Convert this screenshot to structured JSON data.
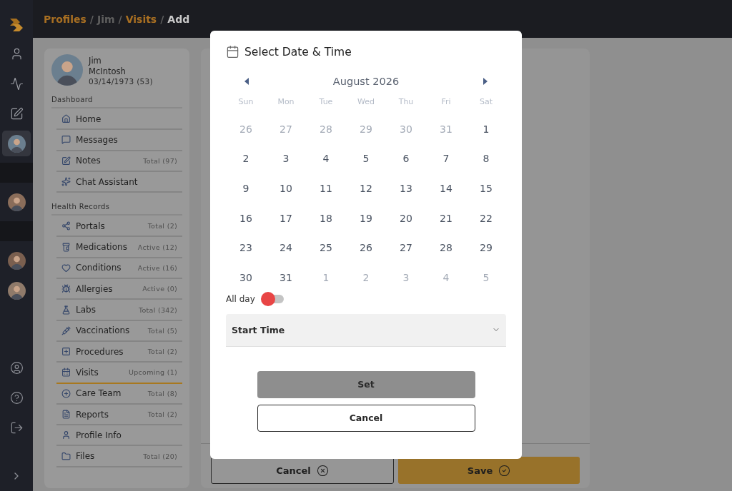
{
  "breadcrumb": [
    {
      "label": "Profiles",
      "kind": "link"
    },
    {
      "label": "/",
      "kind": "separator"
    },
    {
      "label": "Jim",
      "kind": "plain"
    },
    {
      "label": "/",
      "kind": "separator"
    },
    {
      "label": "Visits",
      "kind": "link"
    },
    {
      "label": "/",
      "kind": "separator"
    },
    {
      "label": "Add",
      "kind": "current"
    }
  ],
  "rail": [
    {
      "kind": "icon",
      "selected": false
    },
    {
      "kind": "icon",
      "selected": false
    },
    {
      "kind": "icon",
      "selected": false
    },
    {
      "kind": "avatar",
      "selected": true
    },
    {
      "kind": "band"
    },
    {
      "kind": "avatar",
      "selected": false
    },
    {
      "kind": "band"
    },
    {
      "kind": "avatar",
      "selected": false
    },
    {
      "kind": "avatar",
      "selected": false
    }
  ],
  "profile": {
    "first_name": "Jim",
    "last_name": "McIntosh",
    "birth": "03/14/1973 (53)"
  },
  "sections": [
    {
      "title": "Dashboard",
      "items": [
        {
          "label": "Home",
          "selected": false
        },
        {
          "label": "Messages",
          "selected": false
        },
        {
          "label": "Notes",
          "count": "Total (97)",
          "selected": false
        },
        {
          "label": "Chat Assistant",
          "selected": false
        }
      ]
    },
    {
      "title": "Health Records",
      "items": [
        {
          "label": "Portals",
          "count": "Total (2)",
          "selected": false
        },
        {
          "label": "Medications",
          "count": "Active (12)",
          "selected": false
        },
        {
          "label": "Conditions",
          "count": "Active (16)",
          "selected": false
        },
        {
          "label": "Allergies",
          "count": "Active (0)",
          "selected": false
        },
        {
          "label": "Labs",
          "count": "Total (342)",
          "selected": false
        },
        {
          "label": "Vaccinations",
          "count": "Total (5)",
          "selected": false
        },
        {
          "label": "Procedures",
          "count": "Total (2)",
          "selected": false
        },
        {
          "label": "Visits",
          "count": "Upcoming (1)",
          "selected": true
        },
        {
          "label": "Care Team",
          "count": "Total (8)",
          "selected": false
        },
        {
          "label": "Reports",
          "count": "Total (2)",
          "selected": false
        },
        {
          "label": "Profile Info",
          "selected": false
        },
        {
          "label": "Files",
          "count": "Total (20)",
          "selected": false
        }
      ]
    }
  ],
  "footer_buttons": [
    {
      "label": "Cancel",
      "kind": "outline"
    },
    {
      "label": "Save",
      "kind": "primary"
    }
  ],
  "dialog": {
    "title": "Select Date & Time",
    "month": "August 2026",
    "weekdays": [
      "Sun",
      "Mon",
      "Tue",
      "Wed",
      "Thu",
      "Fri",
      "Sat"
    ],
    "days": [
      {
        "label": "26",
        "muted": true
      },
      {
        "label": "27",
        "muted": true
      },
      {
        "label": "28",
        "muted": true
      },
      {
        "label": "29",
        "muted": true
      },
      {
        "label": "30",
        "muted": true
      },
      {
        "label": "31",
        "muted": true
      },
      {
        "label": "1",
        "muted": false
      },
      {
        "label": "2",
        "muted": false
      },
      {
        "label": "3",
        "muted": false
      },
      {
        "label": "4",
        "muted": false
      },
      {
        "label": "5",
        "muted": false
      },
      {
        "label": "6",
        "muted": false
      },
      {
        "label": "7",
        "muted": false
      },
      {
        "label": "8",
        "muted": false
      },
      {
        "label": "9",
        "muted": false
      },
      {
        "label": "10",
        "muted": false
      },
      {
        "label": "11",
        "muted": false
      },
      {
        "label": "12",
        "muted": false
      },
      {
        "label": "13",
        "muted": false
      },
      {
        "label": "14",
        "muted": false
      },
      {
        "label": "15",
        "muted": false
      },
      {
        "label": "16",
        "muted": false
      },
      {
        "label": "17",
        "muted": false
      },
      {
        "label": "18",
        "muted": false
      },
      {
        "label": "19",
        "muted": false
      },
      {
        "label": "20",
        "muted": false
      },
      {
        "label": "21",
        "muted": false
      },
      {
        "label": "22",
        "muted": false
      },
      {
        "label": "23",
        "muted": false
      },
      {
        "label": "24",
        "muted": false
      },
      {
        "label": "25",
        "muted": false
      },
      {
        "label": "26",
        "muted": false
      },
      {
        "label": "27",
        "muted": false
      },
      {
        "label": "28",
        "muted": false
      },
      {
        "label": "29",
        "muted": false
      },
      {
        "label": "30",
        "muted": false
      },
      {
        "label": "31",
        "muted": false
      },
      {
        "label": "1",
        "muted": true
      },
      {
        "label": "2",
        "muted": true
      },
      {
        "label": "3",
        "muted": true
      },
      {
        "label": "4",
        "muted": true
      },
      {
        "label": "5",
        "muted": true
      }
    ],
    "all_day": {
      "label": "All day",
      "on": false
    },
    "start_time": {
      "placeholder": "Start Time"
    },
    "buttons": [
      {
        "label": "Set",
        "kind": "primary"
      },
      {
        "label": "Cancel",
        "kind": "outline"
      }
    ]
  }
}
